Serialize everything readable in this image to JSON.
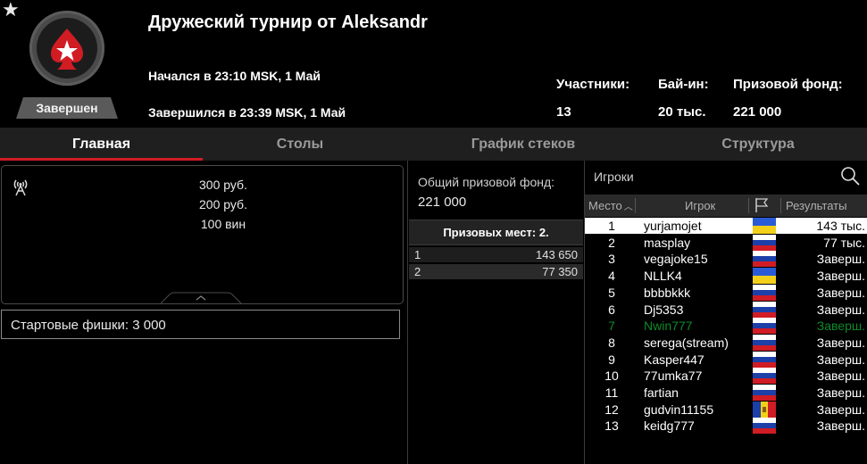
{
  "header": {
    "title": "Дружеский турнир от Aleksandr",
    "started": "Начался в 23:10 MSK, 1 Май",
    "ended": "Завершился в 23:39 MSK, 1 Май",
    "status": "Завершен",
    "stats": [
      {
        "label": "Участники:",
        "value": "13"
      },
      {
        "label": "Бай-ин:",
        "value": "20 тыс."
      },
      {
        "label": "Призовой фонд:",
        "value": "221 000"
      }
    ]
  },
  "tabs": [
    {
      "label": "Главная",
      "active": true
    },
    {
      "label": "Столы",
      "active": false
    },
    {
      "label": "График стеков",
      "active": false
    },
    {
      "label": "Структура",
      "active": false
    }
  ],
  "main": {
    "prizes": [
      "300 руб.",
      "200 руб.",
      "100 вин"
    ],
    "starting_chips": "Стартовые фишки:  3 000"
  },
  "payouts": {
    "total_label": "Общий призовой фонд:",
    "total_value": "221 000",
    "places_label": "Призовых мест: 2.",
    "rows": [
      {
        "place": "1",
        "value": "143 650"
      },
      {
        "place": "2",
        "value": "77 350"
      }
    ]
  },
  "players": {
    "title": "Игроки",
    "columns": {
      "place": "Место",
      "player": "Игрок",
      "results": "Результаты"
    },
    "rows": [
      {
        "place": "1",
        "name": "yurjamojet",
        "flag": "ua",
        "result": "143 тыс."
      },
      {
        "place": "2",
        "name": "masplay",
        "flag": "ru",
        "result": "77 тыс."
      },
      {
        "place": "3",
        "name": "vegajoke15",
        "flag": "ru",
        "result": "Заверш."
      },
      {
        "place": "4",
        "name": "NLLK4",
        "flag": "ua",
        "result": "Заверш."
      },
      {
        "place": "5",
        "name": "bbbbkkk",
        "flag": "ru",
        "result": "Заверш."
      },
      {
        "place": "6",
        "name": "Dj5353",
        "flag": "ru",
        "result": "Заверш."
      },
      {
        "place": "7",
        "name": "Nwin777",
        "flag": "ru",
        "result": "Заверш."
      },
      {
        "place": "8",
        "name": "serega(stream)",
        "flag": "ru",
        "result": "Заверш."
      },
      {
        "place": "9",
        "name": "Kasper447",
        "flag": "ru",
        "result": "Заверш."
      },
      {
        "place": "10",
        "name": "77umka77",
        "flag": "ru",
        "result": "Заверш."
      },
      {
        "place": "11",
        "name": "fartian",
        "flag": "ru",
        "result": "Заверш."
      },
      {
        "place": "12",
        "name": "gudvin11155",
        "flag": "md",
        "result": "Заверш."
      },
      {
        "place": "13",
        "name": "keidg777",
        "flag": "ru",
        "result": "Заверш."
      }
    ]
  },
  "colors": {
    "accent": "#d11c24",
    "highlight_player": "#0e8a2a"
  }
}
